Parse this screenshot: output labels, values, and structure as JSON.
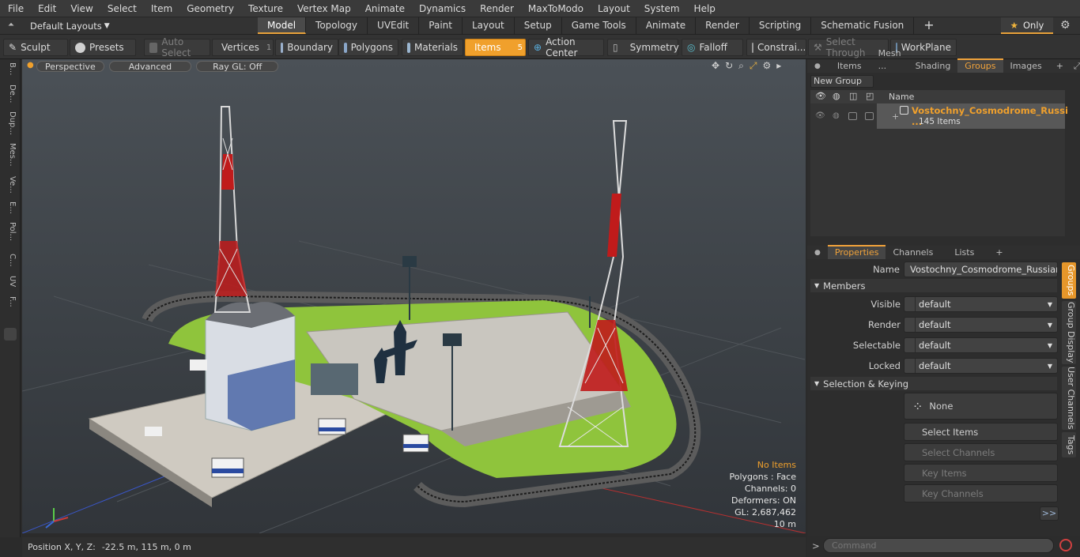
{
  "menu": [
    "File",
    "Edit",
    "View",
    "Select",
    "Item",
    "Geometry",
    "Texture",
    "Vertex Map",
    "Animate",
    "Dynamics",
    "Render",
    "MaxToModo",
    "Layout",
    "System",
    "Help"
  ],
  "layouts": {
    "label": "Default Layouts",
    "tabs": [
      "Model",
      "Topology",
      "UVEdit",
      "Paint",
      "Layout",
      "Setup",
      "Game Tools",
      "Animate",
      "Render",
      "Scripting",
      "Schematic Fusion"
    ],
    "add": "+",
    "only": "Only"
  },
  "toolbar": {
    "sculpt": "Sculpt",
    "presets": "Presets",
    "auto_select": "Auto Select",
    "vertices": "Vertices",
    "vertices_count": "1",
    "boundary": "Boundary",
    "polygons": "Polygons",
    "materials": "Materials",
    "items": "Items",
    "items_count": "5",
    "action_center": "Action Center",
    "symmetry": "Symmetry",
    "falloff": "Falloff",
    "constraints": "Constrai...",
    "select_through": "Select Through",
    "workplane": "WorkPlane"
  },
  "lefttools": [
    "B...",
    "De...",
    "Dup...",
    "Mes...",
    "Ve...",
    "E...",
    "Pol...",
    "C...",
    "UV",
    "F..."
  ],
  "viewport": {
    "perspective": "Perspective",
    "advanced": "Advanced",
    "raygl": "Ray GL: Off",
    "info": {
      "no_items": "No Items",
      "polygons": "Polygons : Face",
      "channels": "Channels: 0",
      "deformers": "Deformers: ON",
      "gl": "GL: 2,687,462",
      "scale": "10 m"
    }
  },
  "status": {
    "label": "Position X, Y, Z:",
    "value": "-22.5 m, 115 m, 0 m"
  },
  "groups_panel": {
    "tabs": [
      "Items",
      "Mesh ...",
      "Shading",
      "Groups",
      "Images"
    ],
    "active": "Groups",
    "new_group": "New Group",
    "name_header": "Name",
    "group": {
      "name": "Vostochny_Cosmodrome_Russi ...",
      "count": "145 Items"
    }
  },
  "properties": {
    "tabs": [
      "Properties",
      "Channels",
      "Lists"
    ],
    "name_label": "Name",
    "name_value": "Vostochny_Cosmodrome_Russian_Spa",
    "members_section": "Members",
    "rows": [
      {
        "label": "Visible",
        "value": "default"
      },
      {
        "label": "Render",
        "value": "default"
      },
      {
        "label": "Selectable",
        "value": "default"
      },
      {
        "label": "Locked",
        "value": "default"
      }
    ],
    "sel_section": "Selection & Keying",
    "none": "None",
    "select_items": "Select Items",
    "select_channels": "Select Channels",
    "key_items": "Key Items",
    "key_channels": "Key Channels",
    "more": ">>"
  },
  "side_tabs": [
    "Groups",
    "Group Display",
    "User Channels",
    "Tags"
  ],
  "command": {
    "prompt": ">",
    "placeholder": "Command"
  },
  "colors": {
    "accent": "#f0a02c",
    "grass": "#8fc43c",
    "tower_red": "#c01b1b"
  }
}
